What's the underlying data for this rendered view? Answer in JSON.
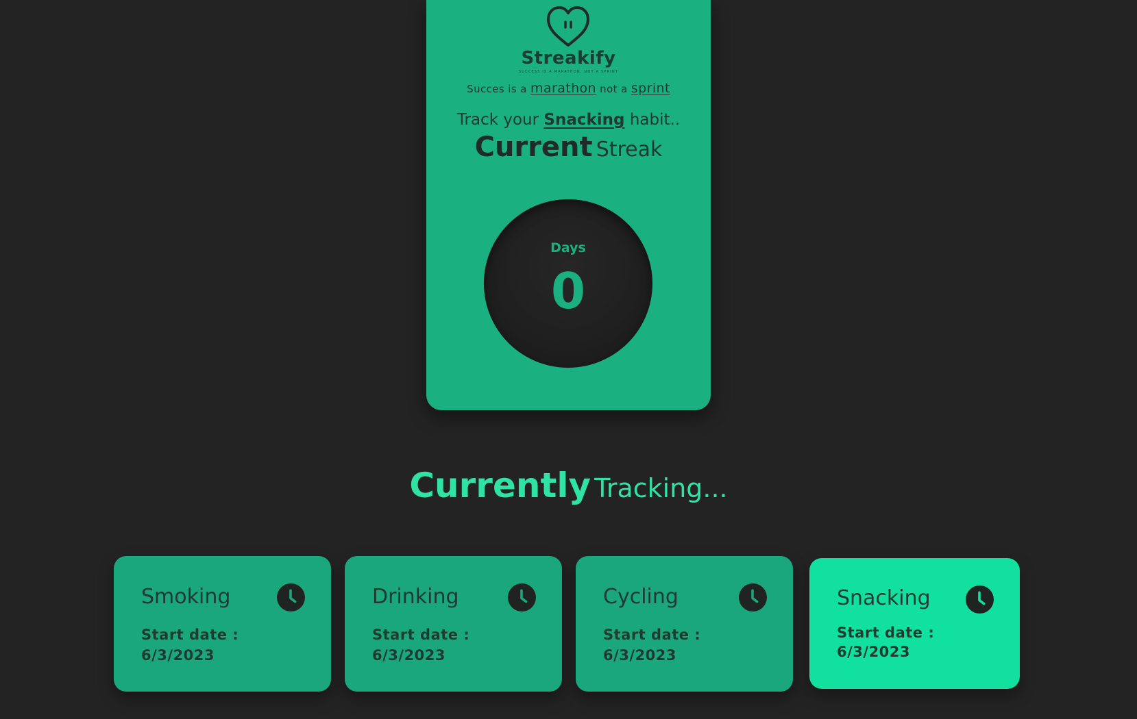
{
  "brand": {
    "name": "Streakify",
    "tagline": "SUCCESS IS A MARATHON, NOT A SPRINT"
  },
  "motto": {
    "prefix": "Succes is a",
    "word1": "marathon",
    "middle": "not a",
    "word2": "sprint"
  },
  "tracker": {
    "prefix": "Track your",
    "habit": "Snacking",
    "suffix": "habit.."
  },
  "streak": {
    "title_bold": "Current",
    "title_light": "Streak",
    "days_label": "Days",
    "days_value": "0"
  },
  "tracking": {
    "title_bold": "Currently",
    "title_light": "Tracking..."
  },
  "habits": [
    {
      "name": "Smoking",
      "date_label": "Start date :",
      "date": "6/3/2023",
      "active": false
    },
    {
      "name": "Drinking",
      "date_label": "Start date :",
      "date": "6/3/2023",
      "active": false
    },
    {
      "name": "Cycling",
      "date_label": "Start date :",
      "date": "6/3/2023",
      "active": false
    },
    {
      "name": "Snacking",
      "date_label": "Start date :",
      "date": "6/3/2023",
      "active": true
    }
  ],
  "icons": {
    "logo": "heart-face-icon",
    "habit": "clock-icon"
  },
  "colors": {
    "background": "#232323",
    "card": "#1ab07f",
    "habit_card": "#1aa77b",
    "habit_card_active": "#12e09f",
    "accent_text": "#2ee3a4",
    "dark": "#1f1f1f"
  }
}
